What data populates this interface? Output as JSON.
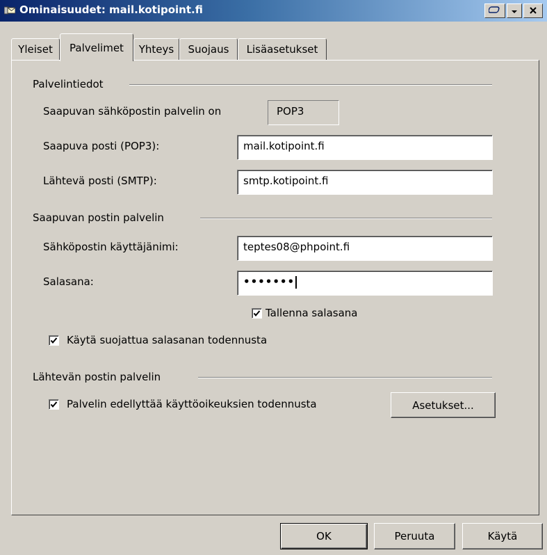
{
  "window": {
    "title": "Ominaisuudet: mail.kotipoint.fi",
    "controls": {
      "help": "help-icon",
      "dropdown": "chevron-down-icon",
      "close": "close-icon"
    }
  },
  "tabs": [
    {
      "label": "Yleiset",
      "selected": false
    },
    {
      "label": "Palvelimet",
      "selected": true
    },
    {
      "label": "Yhteys",
      "selected": false
    },
    {
      "label": "Suojaus",
      "selected": false
    },
    {
      "label": "Lisäasetukset",
      "selected": false
    }
  ],
  "server_info": {
    "heading": "Palvelintiedot",
    "incoming_type_label": "Saapuvan sähköpostin palvelin on",
    "incoming_type_value": "POP3",
    "incoming_label": "Saapuva posti (POP3):",
    "incoming_value": "mail.kotipoint.fi",
    "outgoing_label": "Lähtevä posti (SMTP):",
    "outgoing_value": "smtp.kotipoint.fi"
  },
  "incoming_server": {
    "heading": "Saapuvan postin palvelin",
    "username_label": "Sähköpostin käyttäjänimi:",
    "username_value": "teptes08@phpoint.fi",
    "password_label": "Salasana:",
    "password_value": "•••••••",
    "remember_label": "Tallenna salasana",
    "remember_checked": true,
    "spa_label": "Käytä suojattua salasanan todennusta",
    "spa_checked": true
  },
  "outgoing_server": {
    "heading": "Lähtevän postin palvelin",
    "auth_label": "Palvelin edellyttää käyttöoikeuksien todennusta",
    "auth_checked": true,
    "settings_button": "Asetukset..."
  },
  "buttons": {
    "ok": "OK",
    "cancel": "Peruuta",
    "apply": "Käytä"
  }
}
